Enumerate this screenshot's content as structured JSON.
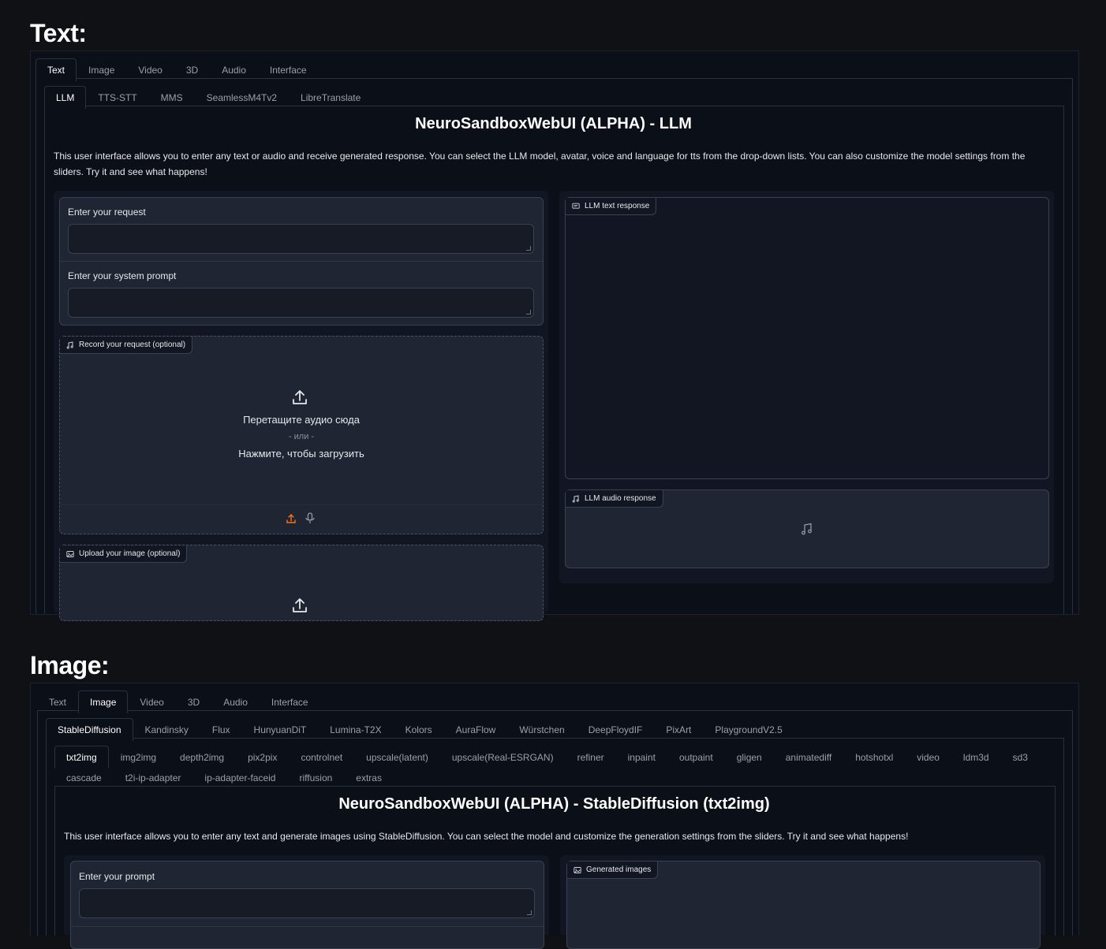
{
  "text_section": {
    "title": "Text:",
    "top_tabs": [
      "Text",
      "Image",
      "Video",
      "3D",
      "Audio",
      "Interface"
    ],
    "active_top_tab": "Text",
    "sub_tabs": [
      "LLM",
      "TTS-STT",
      "MMS",
      "SeamlessM4Tv2",
      "LibreTranslate"
    ],
    "active_sub_tab": "LLM",
    "heading": "NeuroSandboxWebUI (ALPHA) - LLM",
    "description": "This user interface allows you to enter any text or audio and receive generated response. You can select the LLM model, avatar, voice and language for tts from the drop-down lists. You can also customize the model settings from the sliders. Try it and see what happens!",
    "request_label": "Enter your request",
    "system_prompt_label": "Enter your system prompt",
    "record_label": "Record your request (optional)",
    "upload_drop_text": "Перетащите аудио сюда",
    "upload_or": "- или -",
    "upload_click": "Нажмите, чтобы загрузить",
    "upload_image_label": "Upload your image (optional)",
    "text_response_label": "LLM text response",
    "audio_response_label": "LLM audio response"
  },
  "image_section": {
    "title": "Image:",
    "top_tabs": [
      "Text",
      "Image",
      "Video",
      "3D",
      "Audio",
      "Interface"
    ],
    "active_top_tab": "Image",
    "model_tabs": [
      "StableDiffusion",
      "Kandinsky",
      "Flux",
      "HunyuanDiT",
      "Lumina-T2X",
      "Kolors",
      "AuraFlow",
      "Würstchen",
      "DeepFloydIF",
      "PixArt",
      "PlaygroundV2.5"
    ],
    "active_model_tab": "StableDiffusion",
    "mode_tabs_row1": [
      "txt2img",
      "img2img",
      "depth2img",
      "pix2pix",
      "controlnet",
      "upscale(latent)",
      "upscale(Real-ESRGAN)",
      "refiner",
      "inpaint",
      "outpaint",
      "gligen",
      "animatediff",
      "hotshotxl",
      "video",
      "ldm3d",
      "sd3"
    ],
    "mode_tabs_row2": [
      "cascade",
      "t2i-ip-adapter",
      "ip-adapter-faceid",
      "riffusion",
      "extras"
    ],
    "active_mode_tab": "txt2img",
    "heading": "NeuroSandboxWebUI (ALPHA) - StableDiffusion (txt2img)",
    "description": "This user interface allows you to enter any text and generate images using StableDiffusion. You can select the model and customize the generation settings from the sliders. Try it and see what happens!",
    "prompt_label": "Enter your prompt",
    "generated_label": "Generated images"
  },
  "colors": {
    "background": "#0f1115",
    "panel": "#0b0f18",
    "card": "#1f2532",
    "accent_upload": "#f97316"
  }
}
